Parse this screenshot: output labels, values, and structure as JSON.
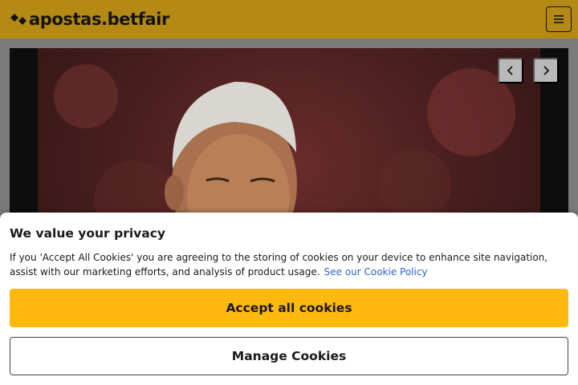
{
  "header": {
    "logo_text": "apostas.betfair",
    "logo_icon": "betfair-diamond-arrows-icon",
    "menu_icon": "hamburger-menu-icon"
  },
  "carousel": {
    "image": "football-player-portrait",
    "prev_icon": "chevron-left-icon",
    "next_icon": "chevron-right-icon"
  },
  "consent": {
    "title": "We value your privacy",
    "body": "If you 'Accept All Cookies' you are agreeing to the storing of cookies on your device to enhance site navigation, assist with our marketing efforts, and analysis of product usage.",
    "policy_link": "See our Cookie Policy",
    "accept_label": "Accept all cookies",
    "manage_label": "Manage Cookies"
  },
  "colors": {
    "header_bg": "#b48a14",
    "accent_yellow": "#ffb80c",
    "link_blue": "#2d63c8"
  }
}
